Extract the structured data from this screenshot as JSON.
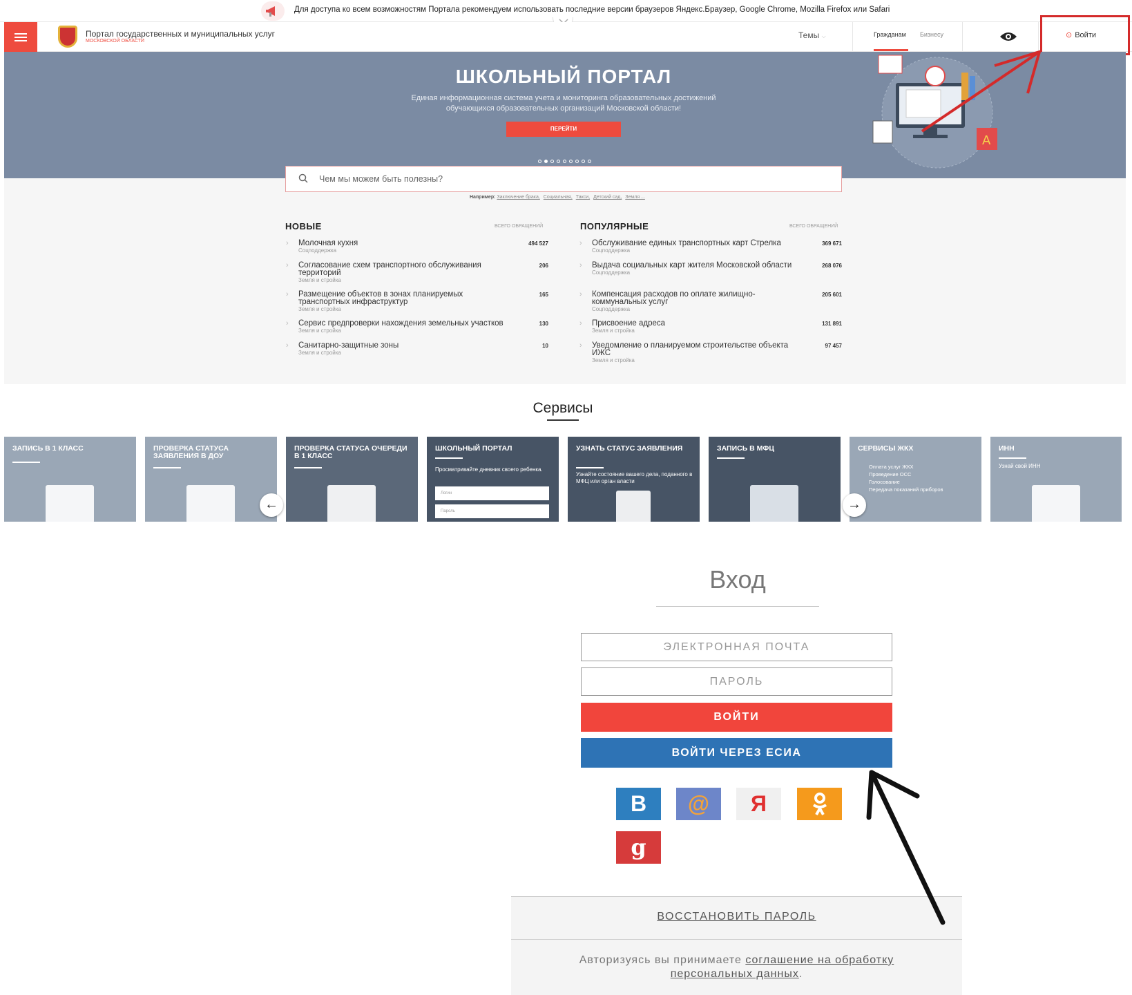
{
  "notice": {
    "text": "Для доступа ко всем возможностям Портала рекомендуем использовать последние версии браузеров Яндекс.Браузер, Google Chrome, Mozilla Firefox или Safari"
  },
  "header": {
    "title": "Портал государственных и муниципальных услуг",
    "subtitle": "московской области",
    "topics": "Темы",
    "citizens": "Гражданам",
    "business": "Бизнесу",
    "login": "Войти"
  },
  "hero": {
    "title": "ШКОЛЬНЫЙ ПОРТАЛ",
    "description": "Единая информационная система учета и мониторинга образовательных достижений обучающихся образовательных организаций Московской области!",
    "button": "ПЕРЕЙТИ"
  },
  "search": {
    "placeholder": "Чем мы можем быть полезны?",
    "examples_label": "Например:",
    "examples": [
      "Заключение брака,",
      "Социальная,",
      "Такси,",
      "Детский сад,",
      "Земля ..."
    ]
  },
  "new_list": {
    "title": "НОВЫЕ",
    "column": "всего обращений",
    "items": [
      {
        "name": "Молочная кухня",
        "category": "Соцподдержка",
        "count": "494 527"
      },
      {
        "name": "Согласование схем транспортного обслуживания территорий",
        "category": "Земля и стройка",
        "count": "206"
      },
      {
        "name": "Размещение объектов в зонах планируемых транспортных инфраструктур",
        "category": "Земля и стройка",
        "count": "165"
      },
      {
        "name": "Сервис предпроверки нахождения земельных участков",
        "category": "Земля и стройка",
        "count": "130"
      },
      {
        "name": "Санитарно-защитные зоны",
        "category": "Земля и стройка",
        "count": "10"
      }
    ]
  },
  "popular_list": {
    "title": "ПОПУЛЯРНЫЕ",
    "column": "всего обращений",
    "items": [
      {
        "name": "Обслуживание единых транспортных карт Стрелка",
        "category": "Соцподдержка",
        "count": "369 671"
      },
      {
        "name": "Выдача социальных карт жителя Московской области",
        "category": "Соцподдержка",
        "count": "268 076"
      },
      {
        "name": "Компенсация расходов по оплате жилищно-коммунальных услуг",
        "category": "Соцподдержка",
        "count": "205 601"
      },
      {
        "name": "Присвоение адреса",
        "category": "Земля и стройка",
        "count": "131 891"
      },
      {
        "name": "Уведомление о планируемом строительстве объекта ИЖС",
        "category": "Земля и стройка",
        "count": "97 457"
      }
    ]
  },
  "services": {
    "title": "Сервисы",
    "cards": [
      {
        "title": "ЗАПИСЬ В 1 КЛАСС",
        "desc": ""
      },
      {
        "title": "ПРОВЕРКА СТАТУСА ЗАЯВЛЕНИЯ В ДОУ",
        "desc": ""
      },
      {
        "title": "ПРОВЕРКА СТАТУСА ОЧЕРЕДИ В 1 КЛАСС",
        "desc": ""
      },
      {
        "title": "ШКОЛЬНЫЙ ПОРТАЛ",
        "desc": "Просматривайте дневник своего ребенка.",
        "login": "Логин",
        "password": "Пароль"
      },
      {
        "title": "УЗНАТЬ СТАТУС ЗАЯВЛЕНИЯ",
        "desc": "Узнайте состояние вашего дела, поданного в МФЦ или орган власти"
      },
      {
        "title": "ЗАПИСЬ В МФЦ",
        "desc": ""
      },
      {
        "title": "СЕРВИСЫ ЖКХ",
        "bullets": [
          "Оплата услуг ЖКХ",
          "Проведение ОСС",
          "Голосование",
          "Передача показаний приборов"
        ]
      },
      {
        "title": "ИНН",
        "desc": "Узнай свой ИНН"
      }
    ]
  },
  "login_form": {
    "title": "Вход",
    "email_placeholder": "ЭЛЕКТРОННАЯ ПОЧТА",
    "password_placeholder": "ПАРОЛЬ",
    "login_button": "ВОЙТИ",
    "esia_button": "ВОЙТИ ЧЕРЕЗ ЕСИА",
    "social": [
      {
        "name": "vk",
        "glyph": "В",
        "color": "#2e7fbf"
      },
      {
        "name": "mailru",
        "glyph": "@",
        "color": "#6d86c9"
      },
      {
        "name": "yandex",
        "glyph": "Я",
        "color": "#f0f0f0"
      },
      {
        "name": "odnoklassniki",
        "glyph": "ok",
        "color": "#f59a1c"
      },
      {
        "name": "google",
        "glyph": "g",
        "color": "#d63b3b"
      }
    ],
    "restore": "ВОССТАНОВИТЬ ПАРОЛЬ",
    "agree_prefix": "Авторизуясь вы принимаете",
    "agree_link": "соглашение на обработку персональных данных",
    "agree_suffix": "."
  },
  "colors": {
    "accent": "#ee4b3e",
    "esia": "#2e73b5",
    "hero": "#7b8ba3"
  }
}
